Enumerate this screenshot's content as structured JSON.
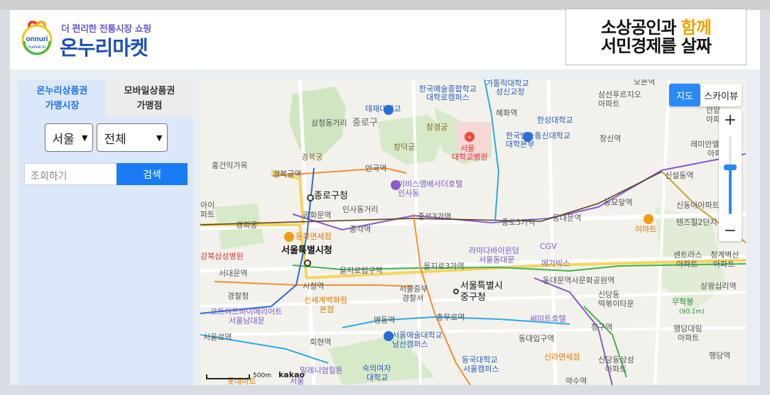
{
  "header": {
    "logo_sub": "더 편리한 전통시장 쇼핑",
    "logo_title": "온누리마켓",
    "logo_mark_text": "onnuri market.kr",
    "banner_line1_a": "소상공인과 ",
    "banner_line1_b": "함께",
    "banner_line2": "서민경제를 살짜"
  },
  "sidebar": {
    "tabs": [
      {
        "label": "온누리상품권\n가맹시장",
        "active": true
      },
      {
        "label": "모바일상품권\n가맹점",
        "active": false
      }
    ],
    "city_select": "서울",
    "district_select": "전체",
    "search_placeholder": "조회하기",
    "search_button": "검색"
  },
  "map": {
    "type_buttons": {
      "map": "지도",
      "skyview": "스카이뷰"
    },
    "zoom_in": "+",
    "zoom_out": "−",
    "zoom_level": 0.42,
    "scale_label": "500m",
    "provider": "kakao",
    "labels": {
      "l1": "가톨릭대학교",
      "l2": "성신교정",
      "l3": "모본역",
      "l4": "한국예술종합학교",
      "l5": "대학로캠퍼스",
      "l6": "삼선푸르지오",
      "l7": "아파트",
      "l8": "태재대학교",
      "l9": "혜화역",
      "l10": "한성대학교",
      "l11": "삼청동거리",
      "l12": "종로구",
      "l13": "창경궁",
      "l14": "한국방송통신대학교",
      "l15": "대학본부",
      "l16": "창신역",
      "l17": "창덕궁",
      "l18": "경복궁",
      "l19": "서울",
      "l20": "대학교병원",
      "l21": "래미안엘리니티",
      "l22": "아파트",
      "l23": "홍건익가옥",
      "l24": "경복궁역",
      "l25": "안국역",
      "l26": "종로구청",
      "l27": "이비스앰배서더호텔",
      "l28": "인사동",
      "l29": "신설동역",
      "l30": "동묘앞역",
      "l31": "인사동거리",
      "l32": "광화문역",
      "l33": "종로3가역",
      "l34": "종로5가역",
      "l35": "동대문역",
      "l36": "신동아아파트",
      "l37": "경희궁",
      "l38": "종각역",
      "l39": "텐즈힐2단지",
      "l40": "이마트",
      "l41": "동화면세점",
      "l42": "라마다바이윈덤",
      "l43": "서울동대문",
      "l44": "CGV",
      "l45": "서울특별시청",
      "l46": "강북삼성병원",
      "l47": "을지로입구역",
      "l48": "을지로3가역",
      "l49": "메가박스",
      "l50": "센트라스",
      "l51": "청계벽산",
      "l52": "서대문역",
      "l53": "시청역",
      "l54": "서울중부",
      "l55": "경찰서",
      "l56": "서울특별시",
      "l57": "중구청",
      "l58": "동대문역사문화공원역",
      "l59": "상왕십리역",
      "l60": "경찰청",
      "l61": "신세계백화점",
      "l62": "본점",
      "l63": "신당동",
      "l64": "떡볶이타운",
      "l65": "무학봉",
      "l66": "코트야드바이메리어트",
      "l67": "서울남대문",
      "l68": "명동역",
      "l69": "충무로역",
      "l70": "써미트호텔",
      "l71": "청구역",
      "l72": "행당대림",
      "l73": "아파트",
      "l74": "서울로역",
      "l75": "회현역",
      "l76": "서울애술대학교",
      "l77": "남산캠퍼스",
      "l78": "동대입구역",
      "l79": "행당역",
      "l80": "동국대학교",
      "l81": "서울캠퍼스",
      "l82": "신라면세점",
      "l83": "신당동삼성",
      "l84": "아파트",
      "l85": "밀레니엄힐튼",
      "l86": "숙의여자",
      "l87": "대학교",
      "l88": "약수역",
      "l89": "안암",
      "l90": "아파트",
      "l91": "아이",
      "l92": "파트",
      "l93": "(90.1m)",
      "l94": "롯데마트",
      "l95": "서울",
      "l96": "아파트",
      "l97": "아파트"
    }
  }
}
